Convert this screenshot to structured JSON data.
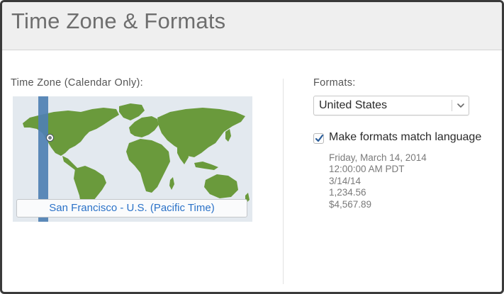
{
  "header": {
    "title": "Time Zone & Formats"
  },
  "time_zone": {
    "label": "Time Zone (Calendar Only):",
    "location": "San Francisco - U.S. (Pacific Time)",
    "map_icon": "world-map"
  },
  "formats": {
    "label": "Formats:",
    "region_selected": "United States",
    "dropdown_icon": "chevron-down-icon",
    "match_language": {
      "checked": true,
      "label": "Make formats match language"
    },
    "samples": [
      "Friday, March 14, 2014",
      "12:00:00 AM PDT",
      "3/14/14",
      "1,234.56",
      "$4,567.89"
    ]
  },
  "colors": {
    "accent_blue": "#2b72c8",
    "timezone_band": "#4f80b3",
    "map_land": "#6a9a3c",
    "map_water": "#e3e9ef"
  }
}
